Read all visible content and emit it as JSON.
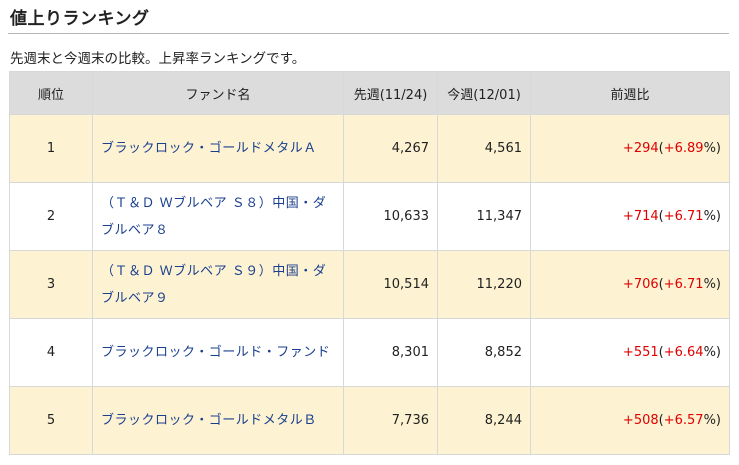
{
  "page": {
    "title": "値上りランキング",
    "description": "先週末と今週末の比較。上昇率ランキングです。"
  },
  "table": {
    "headers": {
      "rank": "順位",
      "fund": "ファンド名",
      "prev": "先週(11/24)",
      "curr": "今週(12/01)",
      "diff": "前週比"
    },
    "rows": [
      {
        "rank": "1",
        "fund": "ブラックロック・ゴールドメタルＡ",
        "prev": "4,267",
        "curr": "4,561",
        "change": "+294",
        "pct": "+6.89"
      },
      {
        "rank": "2",
        "fund": "（Ｔ＆Ｄ Ｗブルベア Ｓ８）中国・ダブルベア８",
        "prev": "10,633",
        "curr": "11,347",
        "change": "+714",
        "pct": "+6.71"
      },
      {
        "rank": "3",
        "fund": "（Ｔ＆Ｄ Ｗブルベア Ｓ９）中国・ダブルベア９",
        "prev": "10,514",
        "curr": "11,220",
        "change": "+706",
        "pct": "+6.71"
      },
      {
        "rank": "4",
        "fund": "ブラックロック・ゴールド・ファンド",
        "prev": "8,301",
        "curr": "8,852",
        "change": "+551",
        "pct": "+6.64"
      },
      {
        "rank": "5",
        "fund": "ブラックロック・ゴールドメタルＢ",
        "prev": "7,736",
        "curr": "8,244",
        "change": "+508",
        "pct": "+6.57"
      }
    ]
  },
  "colors": {
    "odd_row_bg": "#fdf3d3",
    "header_bg": "#dcdcdc",
    "link": "#1a3f8f",
    "positive": "#e00000"
  }
}
